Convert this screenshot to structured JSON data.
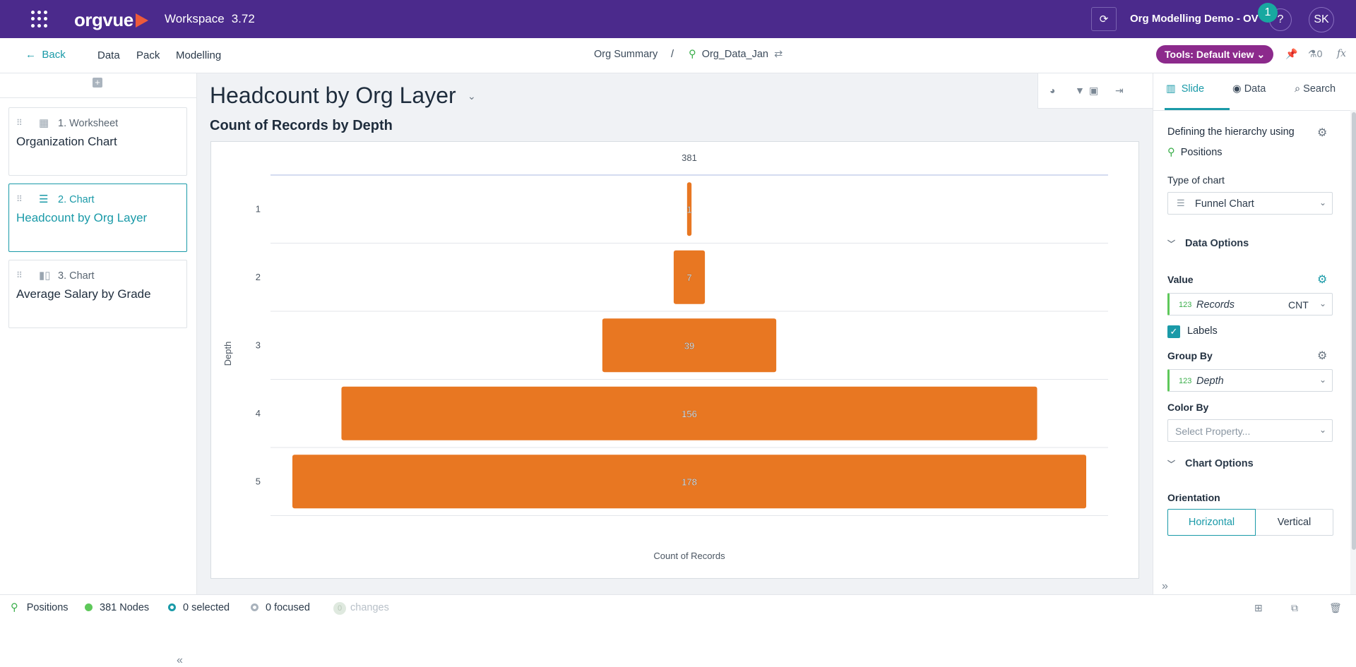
{
  "topbar": {
    "logo": "orgvue",
    "workspace_label": "Workspace",
    "version": "3.72",
    "project": "Org Modelling Demo - OV",
    "notification_count": "1",
    "help": "?",
    "avatar_initials": "SK"
  },
  "navbar": {
    "back": "Back",
    "items": [
      "Data",
      "Pack",
      "Modelling"
    ],
    "breadcrumb": {
      "pack": "Org Summary",
      "separator": "/",
      "dataset": "Org_Data_Jan"
    },
    "tools_label": "Tools: Default view",
    "pin_count": "0",
    "fx": "fx"
  },
  "slides": [
    {
      "type": "1. Worksheet",
      "title": "Organization Chart",
      "icon": "worksheet-icon"
    },
    {
      "type": "2. Chart",
      "title": "Headcount by Org Layer",
      "icon": "funnel-chart-icon"
    },
    {
      "type": "3. Chart",
      "title": "Average Salary by Grade",
      "icon": "bar-chart-icon"
    }
  ],
  "main": {
    "slide_title": "Headcount by Org Layer",
    "chart_title": "Count of Records by Depth"
  },
  "chart_data": {
    "type": "bar",
    "subtype": "funnel",
    "orientation": "horizontal",
    "total_label": "381",
    "categories": [
      "1",
      "2",
      "3",
      "4",
      "5"
    ],
    "values": [
      1,
      7,
      39,
      156,
      178
    ],
    "xlabel": "Count of Records",
    "ylabel": "Depth",
    "bar_color": "#e87722",
    "data_labels": true
  },
  "rightpanel": {
    "tabs": [
      "Slide",
      "Data",
      "Search"
    ],
    "hierarchy_label": "Defining the hierarchy using",
    "hierarchy_value": "Positions",
    "chart_type_label": "Type of chart",
    "chart_type_value": "Funnel Chart",
    "data_options": "Data Options",
    "value_label": "Value",
    "value_tag": "123",
    "value_field": "Records",
    "value_agg": "CNT",
    "labels_checkbox": "Labels",
    "group_by_label": "Group By",
    "group_by_tag": "123",
    "group_by_field": "Depth",
    "color_by_label": "Color By",
    "color_by_placeholder": "Select Property...",
    "chart_options": "Chart Options",
    "orientation_label": "Orientation",
    "orientation_options": [
      "Horizontal",
      "Vertical"
    ],
    "orientation_selected": "Horizontal"
  },
  "statusbar": {
    "positions": "Positions",
    "nodes": "381 Nodes",
    "selected": "0 selected",
    "focused": "0 focused",
    "changes_count": "0",
    "changes": "changes"
  },
  "colors": {
    "topbar": "#4b2a8c",
    "accent": "#1a9aa8",
    "tools_pill": "#8c2a8c",
    "bar": "#e87722",
    "tag_green": "#3aae4a"
  }
}
